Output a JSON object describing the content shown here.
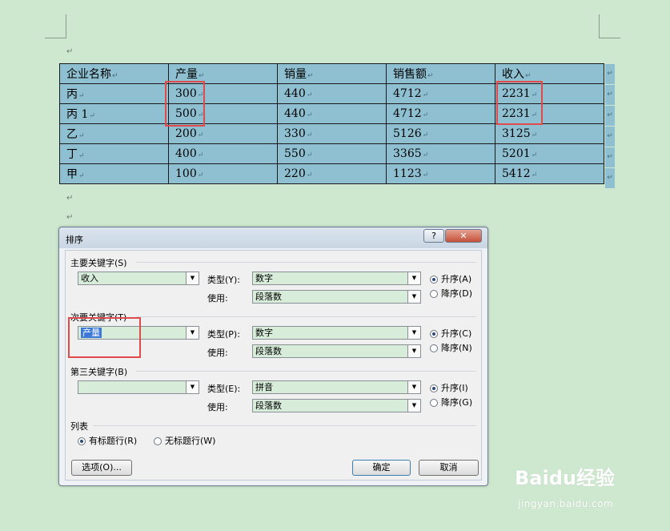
{
  "pilcrow": "↵",
  "table": {
    "rows": [
      [
        "企业名称",
        "产量",
        "销量",
        "销售额",
        "收入"
      ],
      [
        "丙",
        "300",
        "440",
        "4712",
        "2231"
      ],
      [
        "丙 1",
        "500",
        "440",
        "4712",
        "2231"
      ],
      [
        "乙",
        "200",
        "330",
        "5126",
        "3125"
      ],
      [
        "丁",
        "400",
        "550",
        "3365",
        "5201"
      ],
      [
        "甲",
        "100",
        "220",
        "1123",
        "5412"
      ]
    ]
  },
  "dialog": {
    "title": "排序",
    "help": "?",
    "close": "✕",
    "primary": {
      "label": "主要关键字(S)",
      "key": "收入",
      "type_label": "类型(Y):",
      "type_value": "数字",
      "use_label": "使用:",
      "use_value": "段落数",
      "asc": "升序(A)",
      "desc": "降序(D)"
    },
    "secondary": {
      "label": "次要关键字(T)",
      "key": "产量",
      "type_label": "类型(P):",
      "type_value": "数字",
      "use_label": "使用:",
      "use_value": "段落数",
      "asc": "升序(C)",
      "desc": "降序(N)"
    },
    "third": {
      "label": "第三关键字(B)",
      "key": "",
      "type_label": "类型(E):",
      "type_value": "拼音",
      "use_label": "使用:",
      "use_value": "段落数",
      "asc": "升序(I)",
      "desc": "降序(G)"
    },
    "list": {
      "label": "列表",
      "header_yes": "有标题行(R)",
      "header_no": "无标题行(W)"
    },
    "options_button": "选项(O)...",
    "ok_button": "确定",
    "cancel_button": "取消"
  },
  "watermark": {
    "logo": "Baidu经验",
    "url": "jingyan.baidu.com"
  }
}
